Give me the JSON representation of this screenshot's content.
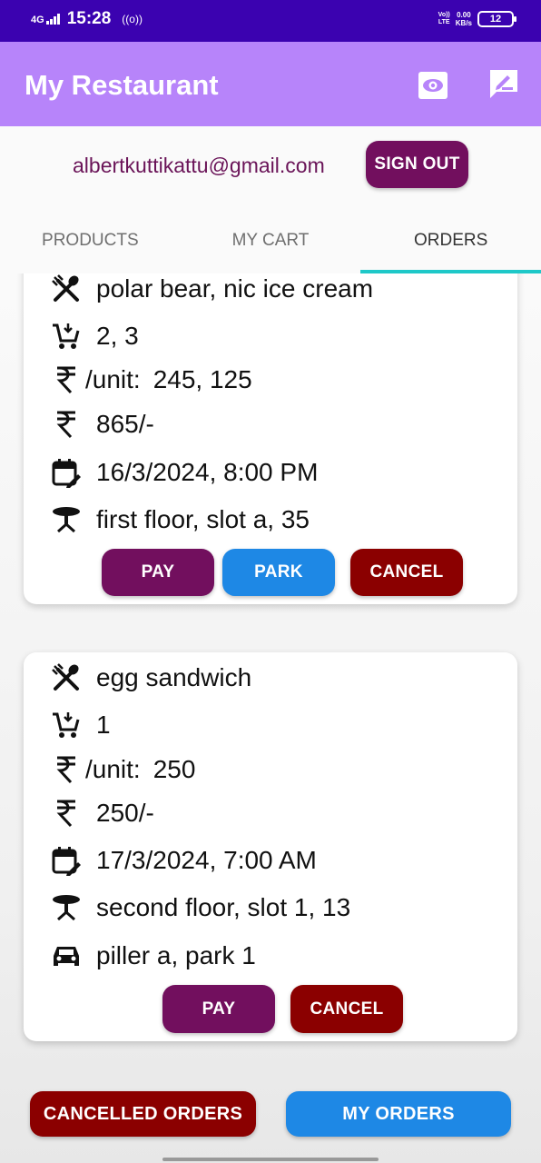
{
  "status_bar": {
    "network": "4G",
    "time": "15:28",
    "hotspot": "((o))",
    "volte_line1": "Vo))",
    "volte_line2": "LTE",
    "speed_value": "0.00",
    "speed_unit": "KB/s",
    "battery": "12"
  },
  "app_bar": {
    "title": "My Restaurant",
    "icons": [
      "eye-icon",
      "edit-icon"
    ]
  },
  "account": {
    "email": "albertkuttikattu@gmail.com",
    "signout_label": "SIGN OUT"
  },
  "tabs": [
    {
      "label": "PRODUCTS",
      "active": false
    },
    {
      "label": "MY CART",
      "active": false
    },
    {
      "label": "ORDERS",
      "active": true
    }
  ],
  "orders": [
    {
      "items": "polar bear, nic ice cream",
      "quantity": "2, 3",
      "unit_price_label": "/unit:",
      "unit_prices": "245, 125",
      "total": "865/-",
      "datetime": "16/3/2024,  8:00 PM",
      "table": "first floor, slot a, 35",
      "buttons": {
        "pay": "PAY",
        "park": "PARK",
        "cancel": "CANCEL"
      }
    },
    {
      "items": "egg sandwich",
      "quantity": "1",
      "unit_price_label": "/unit:",
      "unit_prices": "250",
      "total": "250/-",
      "datetime": "17/3/2024,  7:00 AM",
      "table": "second floor, slot 1, 13",
      "parking": "piller a, park 1",
      "buttons": {
        "pay": "PAY",
        "cancel": "CANCEL"
      }
    }
  ],
  "footer": {
    "cancelled_orders_label": "CANCELLED ORDERS",
    "my_orders_label": "MY ORDERS"
  },
  "colors": {
    "status_bar": "#3b02b0",
    "app_bar": "#b784fa",
    "purple_button": "#720f5e",
    "blue_button": "#1e88e5",
    "red_button": "#8b0000",
    "tab_indicator": "#1ec8c8",
    "email_text": "#6a1458"
  }
}
